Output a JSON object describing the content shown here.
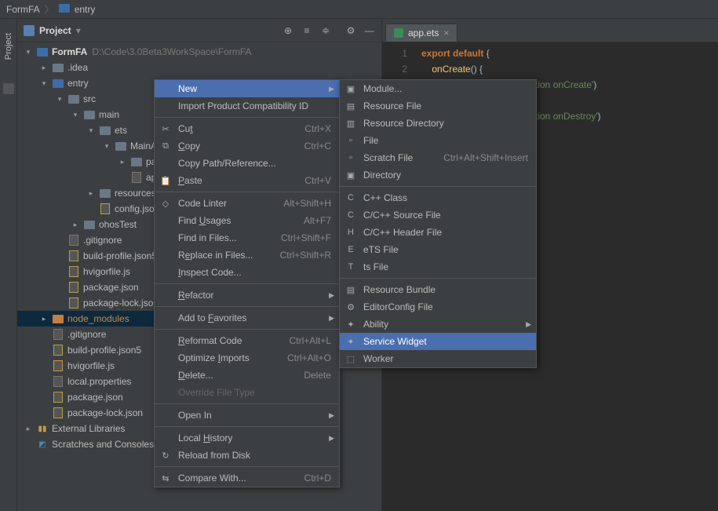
{
  "breadcrumb": {
    "project": "FormFA",
    "module": "entry"
  },
  "tool_strip": {
    "label": "Project"
  },
  "panel": {
    "title": "Project"
  },
  "tree": {
    "root": {
      "name": "FormFA",
      "path": "D:\\Code\\3.0Beta3WorkSpace\\FormFA"
    },
    "items": [
      ".idea",
      "entry",
      "src",
      "main",
      "ets",
      "MainAbility",
      "pages",
      "app.ets",
      "resources",
      "config.json",
      "ohosTest",
      ".gitignore",
      "build-profile.json5",
      "hvigorfile.js",
      "package.json",
      "package-lock.json",
      "node_modules",
      ".gitignore",
      "build-profile.json5",
      "hvigorfile.js",
      "local.properties",
      "package.json",
      "package-lock.json",
      "External Libraries",
      "Scratches and Consoles"
    ]
  },
  "tab": {
    "name": "app.ets"
  },
  "code": {
    "l1": "export default {",
    "l2_fn": "onCreate",
    "l2_rest": "() {",
    "l3_str": "'Application onCreate'",
    "l6_str": "'Application onDestroy'"
  },
  "menu1": {
    "items": [
      {
        "label": "New",
        "sub": true,
        "sel": true
      },
      {
        "label": "Import Product Compatibility ID"
      },
      {
        "sep": true
      },
      {
        "icon": "✂",
        "label": "Cut",
        "ul": 2,
        "short": "Ctrl+X"
      },
      {
        "icon": "⧉",
        "label": "Copy",
        "ul": 0,
        "short": "Ctrl+C"
      },
      {
        "label": "Copy Path/Reference..."
      },
      {
        "icon": "📋",
        "label": "Paste",
        "ul": 0,
        "short": "Ctrl+V"
      },
      {
        "sep": true
      },
      {
        "icon": "◇",
        "label": "Code Linter",
        "short": "Alt+Shift+H"
      },
      {
        "label": "Find Usages",
        "ul": 5,
        "short": "Alt+F7"
      },
      {
        "label": "Find in Files...",
        "short": "Ctrl+Shift+F"
      },
      {
        "label": "Replace in Files...",
        "ul": 1,
        "short": "Ctrl+Shift+R"
      },
      {
        "label": "Inspect Code...",
        "ul": 0
      },
      {
        "sep": true
      },
      {
        "label": "Refactor",
        "ul": 0,
        "sub": true
      },
      {
        "sep": true
      },
      {
        "label": "Add to Favorites",
        "ul": 7,
        "sub": true
      },
      {
        "sep": true
      },
      {
        "label": "Reformat Code",
        "ul": 0,
        "short": "Ctrl+Alt+L"
      },
      {
        "label": "Optimize Imports",
        "ul": 9,
        "short": "Ctrl+Alt+O"
      },
      {
        "label": "Delete...",
        "ul": 0,
        "short": "Delete"
      },
      {
        "label": "Override File Type",
        "disabled": true
      },
      {
        "sep": true
      },
      {
        "label": "Open In",
        "sub": true
      },
      {
        "sep": true
      },
      {
        "label": "Local History",
        "ul": 6,
        "sub": true
      },
      {
        "icon": "↻",
        "label": "Reload from Disk"
      },
      {
        "sep": true
      },
      {
        "icon": "⇆",
        "label": "Compare With...",
        "short": "Ctrl+D"
      }
    ]
  },
  "menu2": {
    "items": [
      {
        "icon": "▣",
        "label": "Module..."
      },
      {
        "icon": "▤",
        "label": "Resource File"
      },
      {
        "icon": "▥",
        "label": "Resource Directory"
      },
      {
        "icon": "▫",
        "label": "File"
      },
      {
        "icon": "▫",
        "label": "Scratch File",
        "short": "Ctrl+Alt+Shift+Insert"
      },
      {
        "icon": "▣",
        "label": "Directory"
      },
      {
        "sep": true
      },
      {
        "icon": "C",
        "label": "C++ Class"
      },
      {
        "icon": "C",
        "label": "C/C++ Source File"
      },
      {
        "icon": "H",
        "label": "C/C++ Header File"
      },
      {
        "icon": "E",
        "label": "eTS File"
      },
      {
        "icon": "T",
        "label": "ts File"
      },
      {
        "sep": true
      },
      {
        "icon": "▤",
        "label": "Resource Bundle"
      },
      {
        "icon": "⚙",
        "label": "EditorConfig File"
      },
      {
        "icon": "✦",
        "label": "Ability",
        "sub": true
      },
      {
        "icon": "✦",
        "label": "Service Widget",
        "sel": true
      },
      {
        "icon": "⬚",
        "label": "Worker"
      }
    ]
  }
}
